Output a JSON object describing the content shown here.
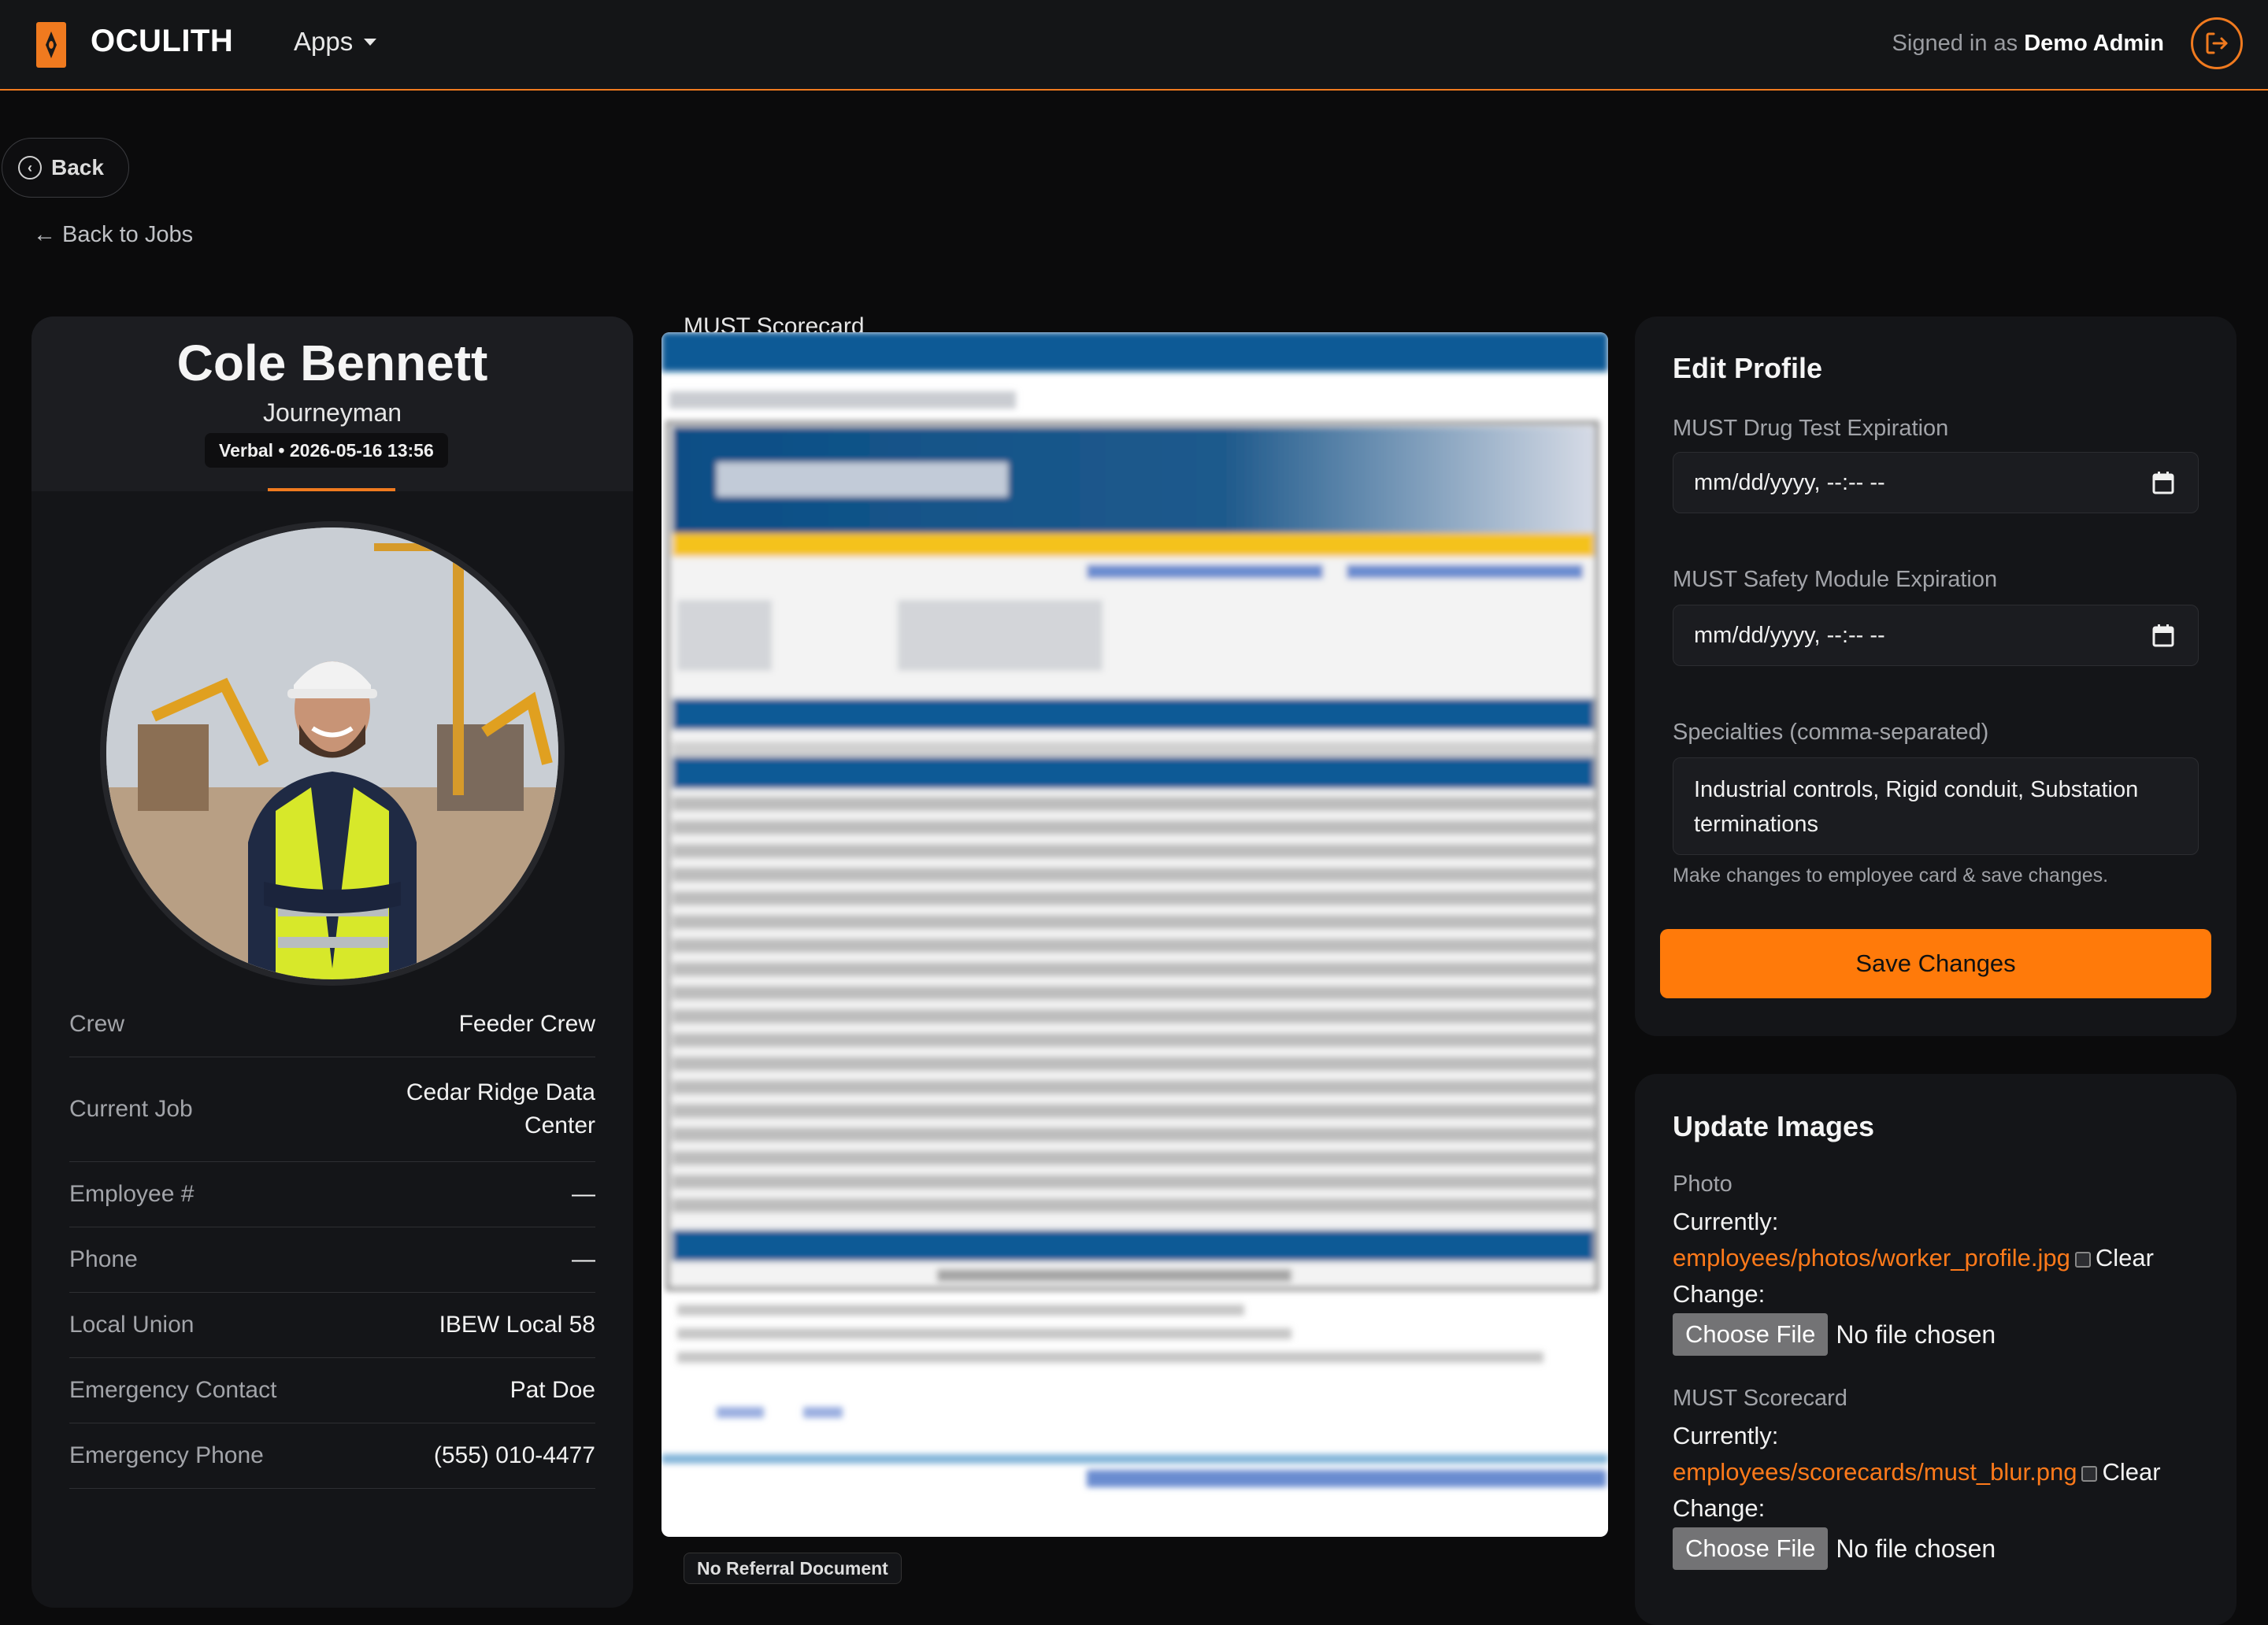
{
  "topbar": {
    "brand": "OCULITH",
    "apps_label": "Apps",
    "signed_in_prefix": "Signed in as",
    "signed_in_user": "Demo Admin",
    "accent_color": "#f07a1f"
  },
  "nav": {
    "back_label": "Back",
    "back_to_jobs": "← Back to Jobs"
  },
  "employee": {
    "name": "Cole Bennett",
    "title": "Journeyman",
    "status": "Verbal • 2026-05-16 13:56",
    "details": [
      {
        "label": "Crew",
        "value": "Feeder Crew"
      },
      {
        "label": "Current Job",
        "value": "Cedar Ridge Data Center"
      },
      {
        "label": "Employee #",
        "value": "—"
      },
      {
        "label": "Phone",
        "value": "—"
      },
      {
        "label": "Local Union",
        "value": "IBEW Local 58"
      },
      {
        "label": "Emergency Contact",
        "value": "Pat Doe"
      },
      {
        "label": "Emergency Phone",
        "value": "(555) 010-4477"
      }
    ]
  },
  "scorecard": {
    "label": "MUST Scorecard",
    "no_referral": "No Referral Document"
  },
  "edit_profile": {
    "title": "Edit Profile",
    "drug_test_label": "MUST Drug Test Expiration",
    "drug_test_placeholder": "mm/dd/yyyy, --:-- --",
    "safety_label": "MUST Safety Module Expiration",
    "safety_placeholder": "mm/dd/yyyy, --:-- --",
    "specialties_label": "Specialties (comma-separated)",
    "specialties_value": "Industrial controls, Rigid conduit, Substation terminations",
    "help_text": "Make changes to employee card & save changes.",
    "save_label": "Save Changes"
  },
  "update_images": {
    "title": "Update Images",
    "photo_label": "Photo",
    "currently": "Currently:",
    "photo_file": "employees/photos/worker_profile.jpg",
    "clear": "Clear",
    "change": "Change:",
    "choose_file": "Choose File",
    "no_file": "No file chosen",
    "scorecard_label": "MUST Scorecard",
    "scorecard_file": "employees/scorecards/must_blur.png"
  }
}
